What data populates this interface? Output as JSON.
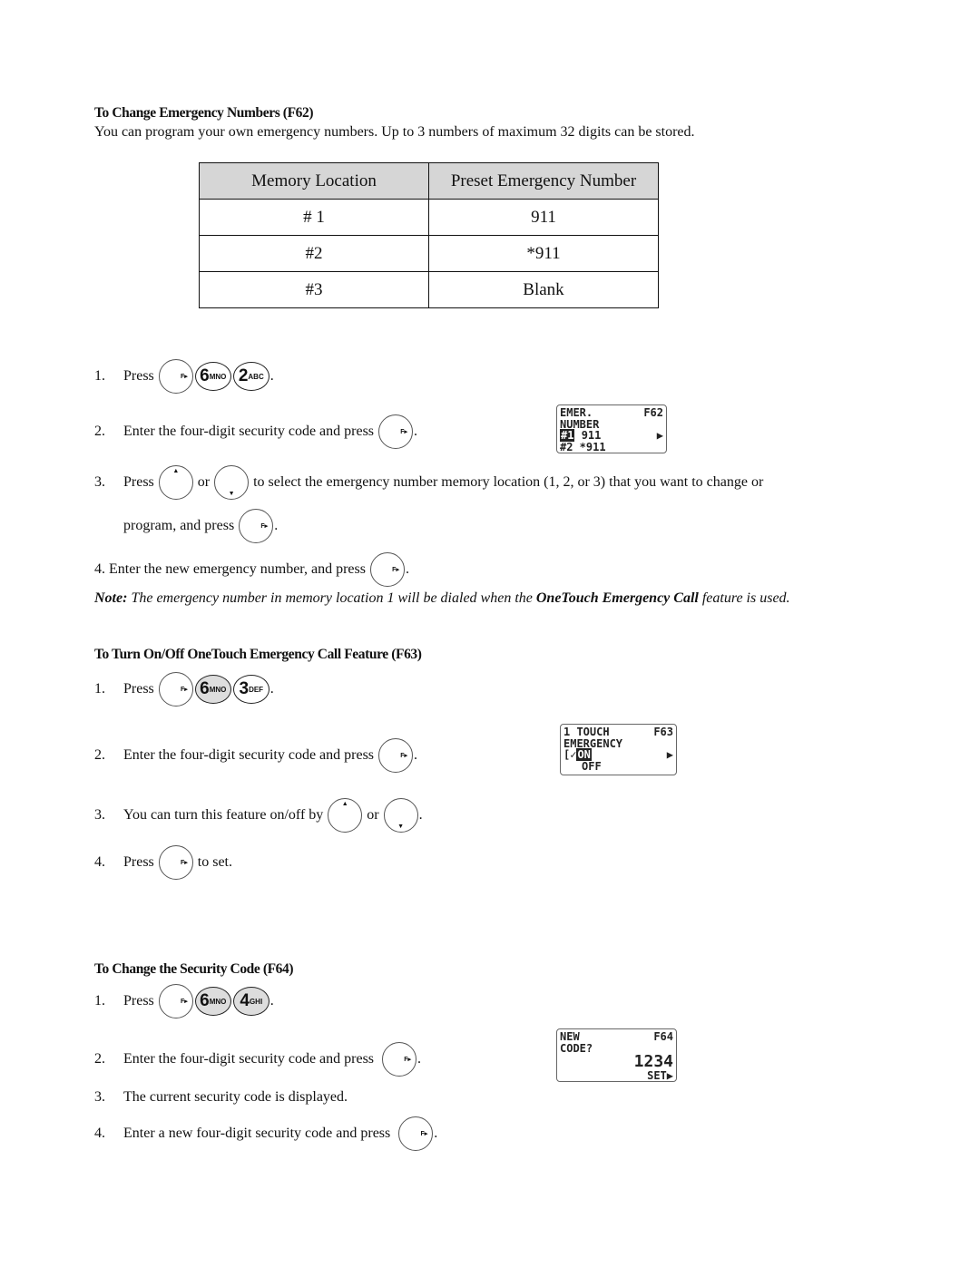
{
  "f62": {
    "heading": "To Change Emergency Numbers (F62)",
    "intro": "You can program your own emergency numbers.  Up to 3 numbers of maximum 32 digits can be stored.",
    "table": {
      "headers": [
        "Memory Location",
        "Preset Emergency Number"
      ],
      "rows": [
        [
          "# 1",
          "911"
        ],
        [
          "#2",
          "*911"
        ],
        [
          "#3",
          "Blank"
        ]
      ]
    },
    "steps": {
      "s1n": "1.",
      "s1": "Press",
      "s2n": "2.",
      "s2": "Enter the four-digit security code and press",
      "s3n": "3.",
      "s3a": "Press",
      "s3b": "or",
      "s3c": "to select the emergency number memory location (1, 2, or 3) that you want to change or",
      "s3d": "program, and press",
      "s4": "4. Enter the new emergency number, and press"
    },
    "lcd": {
      "l1a": "EMER.",
      "l1b": "F62",
      "l2": "NUMBER",
      "l3a": "#1",
      "l3b": "911",
      "l4": "#2 *911"
    },
    "note": {
      "label": "Note:",
      "text1": " The emergency number in memory location 1 will be dialed when the ",
      "bold": "OneTouch Emergency Call",
      "text2": " feature is used."
    }
  },
  "f63": {
    "heading": "To Turn On/Off OneTouch Emergency Call Feature (F63)",
    "steps": {
      "s1n": "1.",
      "s1": "Press",
      "s2n": "2.",
      "s2": "Enter the four-digit security code and press",
      "s3n": "3.",
      "s3a": "You can turn this feature on/off by",
      "s3b": "or",
      "s4n": "4.",
      "s4a": "Press",
      "s4b": "to set."
    },
    "lcd": {
      "l1a": "1 TOUCH",
      "l1b": "F63",
      "l2": "EMERGENCY",
      "l3": "ON",
      "l4": "OFF"
    }
  },
  "f64": {
    "heading": "To Change the Security Code (F64)",
    "steps": {
      "s1n": "1.",
      "s1": "Press",
      "s2n": "2.",
      "s2": "Enter the four-digit security code and press",
      "s3n": "3.",
      "s3": "The current security code is displayed.",
      "s4n": "4.",
      "s4": "Enter a new four-digit security code and press"
    },
    "lcd": {
      "l1a": "NEW",
      "l1b": "F64",
      "l2": "CODE?",
      "l3": "1234",
      "l4": "SET▶"
    }
  },
  "keys": {
    "f": "F▸",
    "six": "6",
    "six_sub": "MNO",
    "two": "2",
    "two_sub": "ABC",
    "three": "3",
    "three_sub": "DEF",
    "four": "4",
    "four_sub": "GHI",
    "up": "▲",
    "down": "▼",
    "period": "."
  }
}
